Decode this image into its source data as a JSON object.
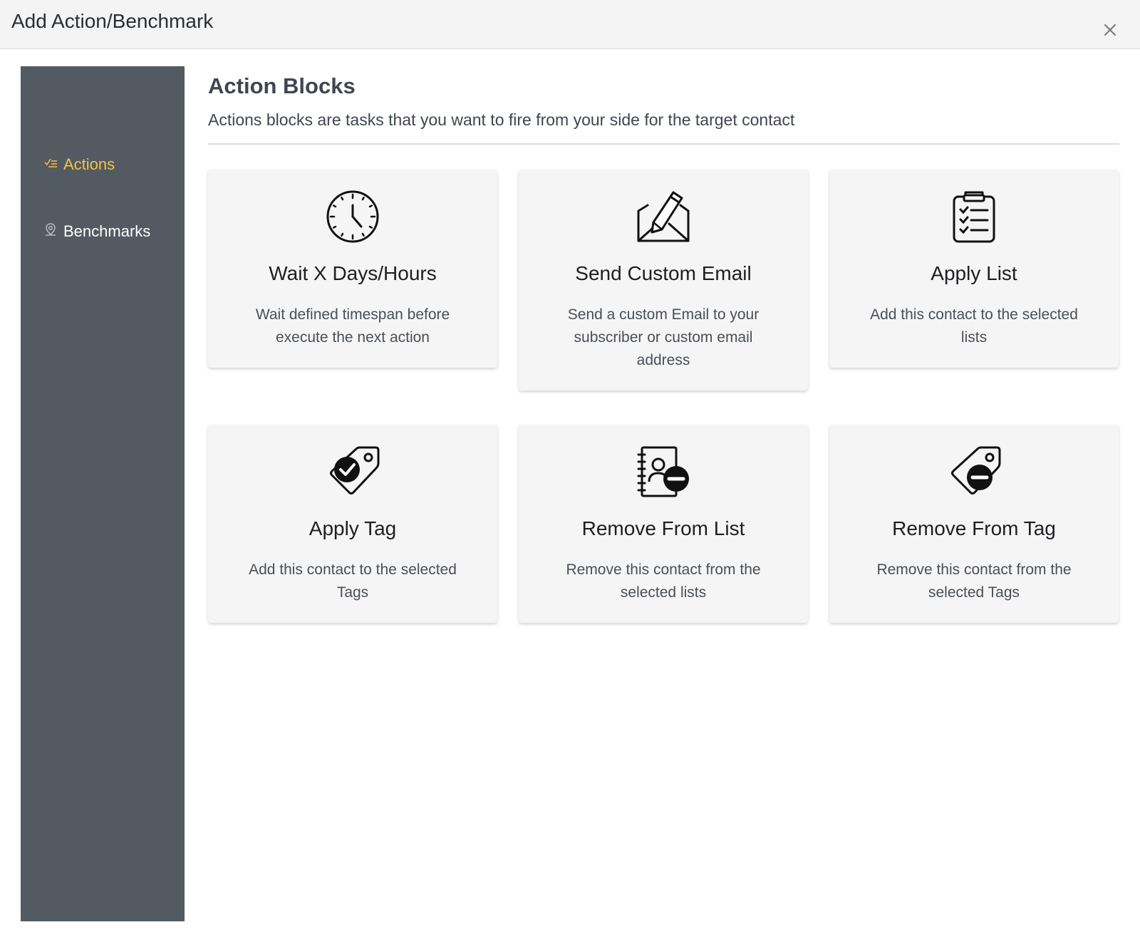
{
  "header": {
    "title": "Add Action/Benchmark",
    "close_icon": "close-icon"
  },
  "sidebar": {
    "items": [
      {
        "label": "Actions",
        "icon": "checklist-icon",
        "active": true
      },
      {
        "label": "Benchmarks",
        "icon": "map-pin-icon",
        "active": false
      }
    ]
  },
  "main": {
    "title": "Action Blocks",
    "description": "Actions blocks are tasks that you want to fire from your side for the target contact",
    "cards": [
      {
        "title": "Wait X Days/Hours",
        "description": "Wait defined timespan before execute the next action",
        "icon": "clock-icon"
      },
      {
        "title": "Send Custom Email",
        "description": "Send a custom Email to your subscriber or custom email address",
        "icon": "email-edit-icon"
      },
      {
        "title": "Apply List",
        "description": "Add this contact to the selected lists",
        "icon": "clipboard-checklist-icon"
      },
      {
        "title": "Apply Tag",
        "description": "Add this contact to the selected Tags",
        "icon": "tag-check-icon"
      },
      {
        "title": "Remove From List",
        "description": "Remove this contact from the selected lists",
        "icon": "address-book-minus-icon"
      },
      {
        "title": "Remove From Tag",
        "description": "Remove this contact from the selected Tags",
        "icon": "tag-minus-icon"
      }
    ]
  },
  "colors": {
    "sidebar_bg": "#535a62",
    "active_accent": "#f5c242",
    "card_bg": "#f5f5f5"
  }
}
